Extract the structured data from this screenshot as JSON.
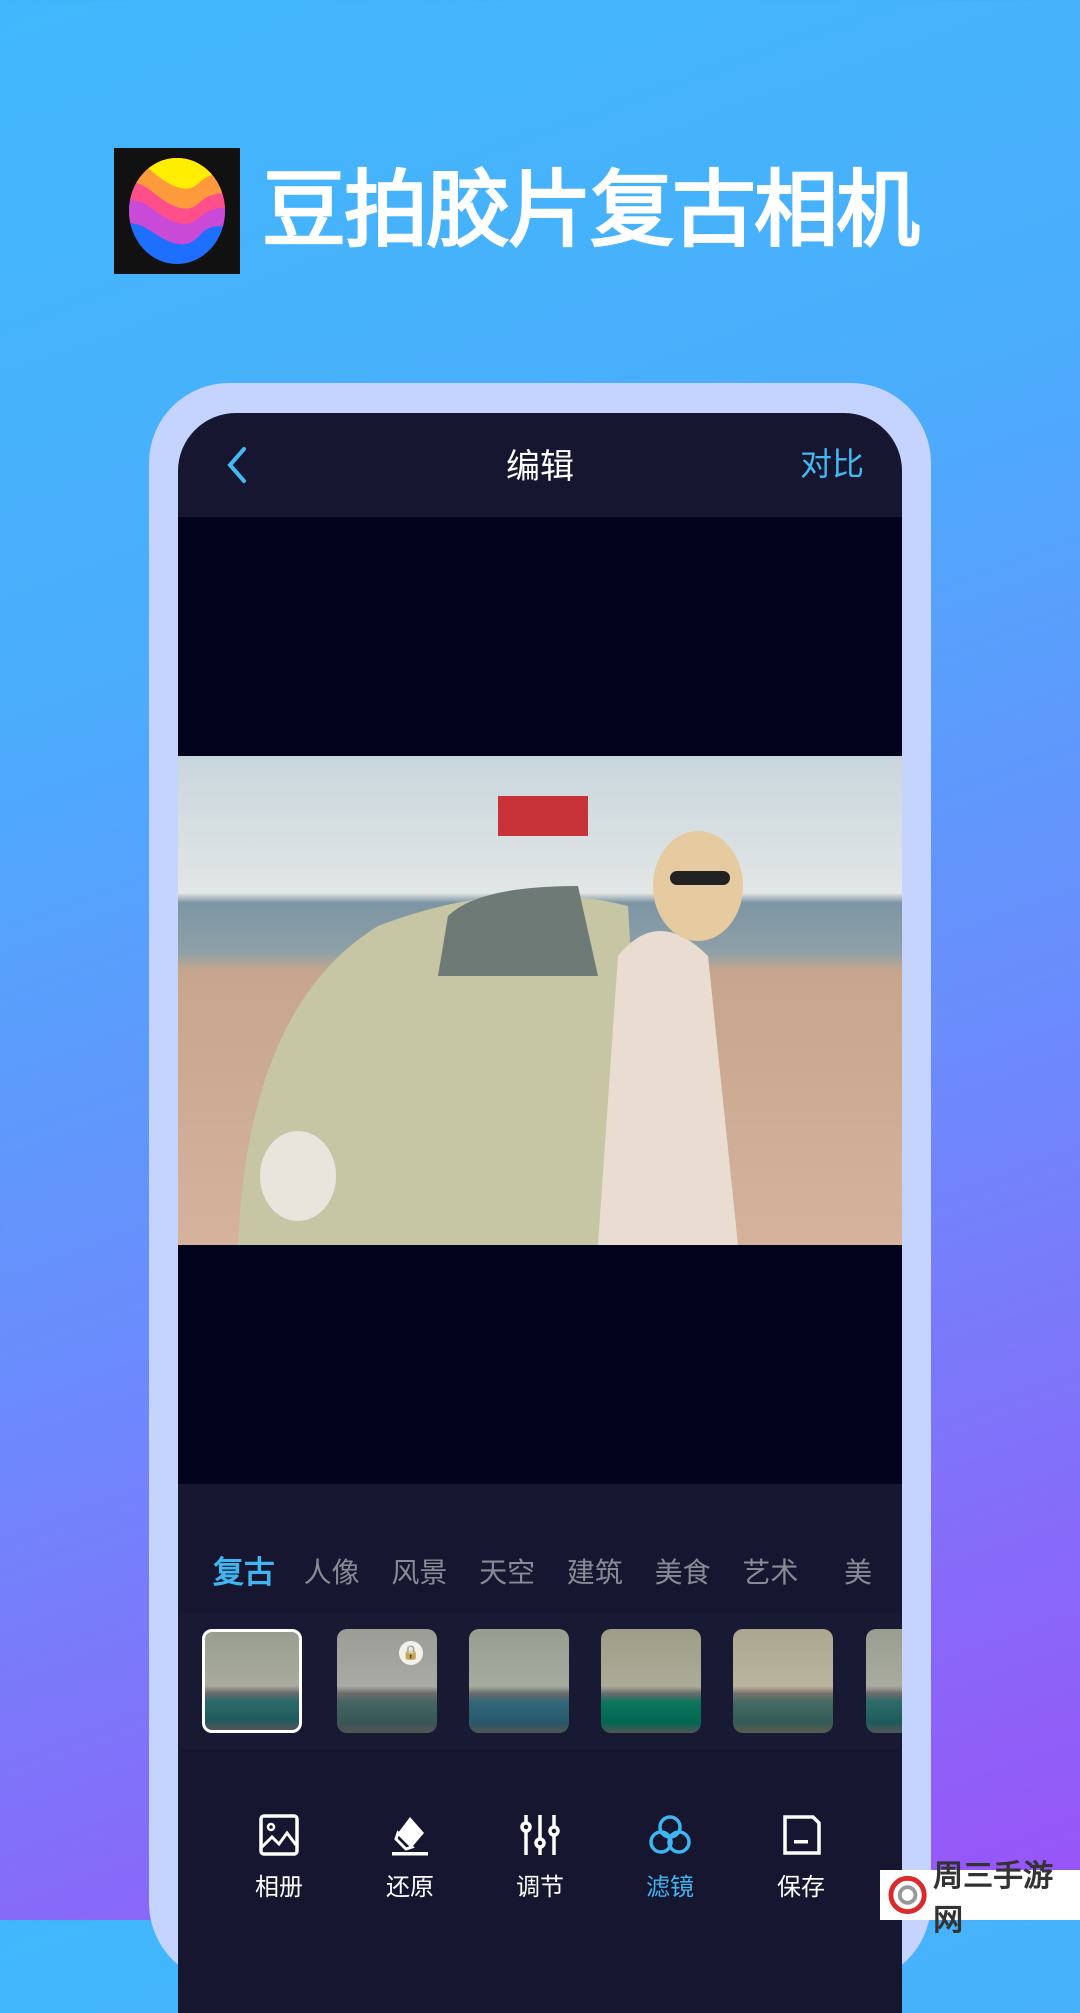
{
  "banner": {
    "title": "豆拍胶片复古相机",
    "logo_colors": [
      "#ffee00",
      "#ff9a3c",
      "#ff4f8b",
      "#c94ad6",
      "#1f6fff"
    ]
  },
  "header": {
    "back_icon": "chevron-left-icon",
    "title": "编辑",
    "compare": "对比"
  },
  "accent": "#3fb6f2",
  "filter_tabs": [
    {
      "label": "复古",
      "active": true
    },
    {
      "label": "人像"
    },
    {
      "label": "风景"
    },
    {
      "label": "天空"
    },
    {
      "label": "建筑"
    },
    {
      "label": "美食"
    },
    {
      "label": "艺术"
    },
    {
      "label": "美"
    }
  ],
  "filters": [
    {
      "selected": true
    },
    {
      "locked": true
    },
    {},
    {},
    {},
    {}
  ],
  "toolbar": [
    {
      "label": "相册",
      "icon": "image-icon"
    },
    {
      "label": "还原",
      "icon": "eraser-icon"
    },
    {
      "label": "调节",
      "icon": "sliders-icon"
    },
    {
      "label": "滤镜",
      "icon": "filter-circles-icon",
      "active": true
    },
    {
      "label": "保存",
      "icon": "save-icon"
    }
  ],
  "watermark": {
    "text": "周三手游网"
  }
}
